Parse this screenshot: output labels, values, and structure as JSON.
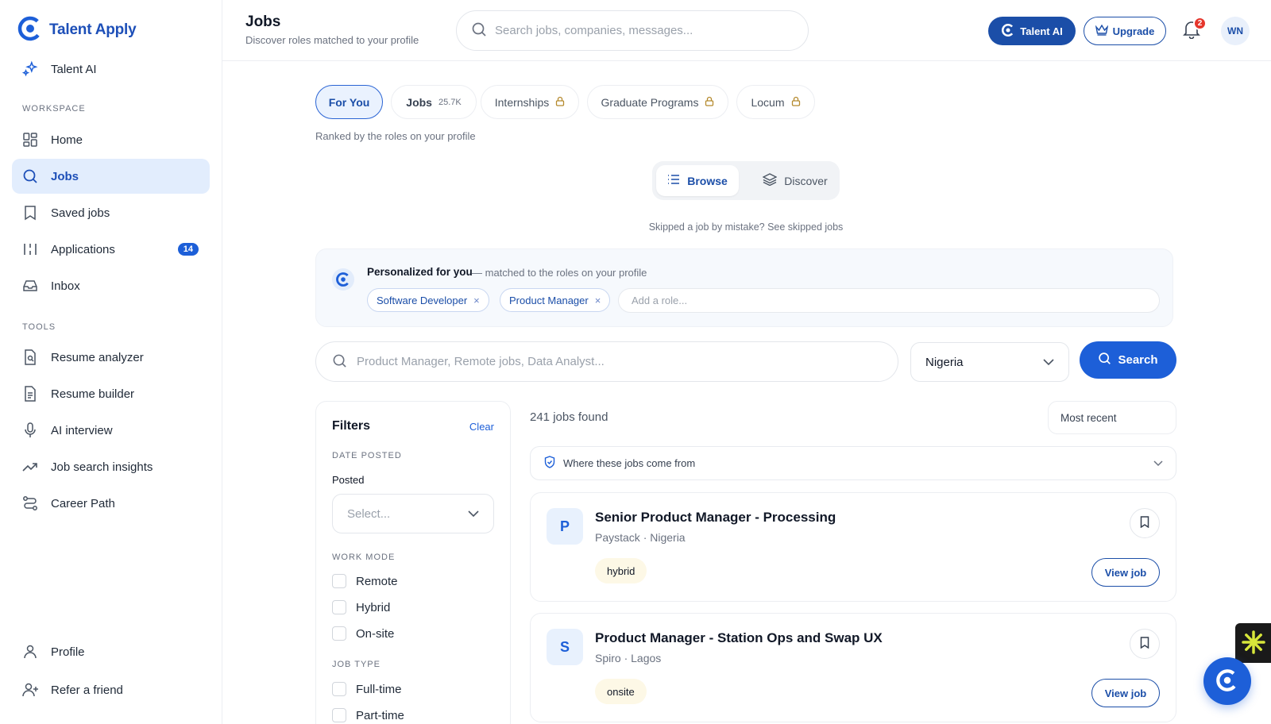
{
  "brand": {
    "name": "Talent Apply"
  },
  "sidebar": {
    "top_item": {
      "label": "Talent AI"
    },
    "workspace_label": "WORKSPACE",
    "workspace": [
      {
        "label": "Home"
      },
      {
        "label": "Jobs",
        "active": true
      },
      {
        "label": "Saved jobs"
      },
      {
        "label": "Applications",
        "badge": "14"
      },
      {
        "label": "Inbox"
      }
    ],
    "tools_label": "TOOLS",
    "tools": [
      {
        "label": "Resume analyzer"
      },
      {
        "label": "Resume builder"
      },
      {
        "label": "AI interview"
      },
      {
        "label": "Job search insights"
      },
      {
        "label": "Career Path"
      }
    ],
    "bottom": [
      {
        "label": "Profile"
      },
      {
        "label": "Refer a friend"
      }
    ]
  },
  "header": {
    "title": "Jobs",
    "subtitle": "Discover roles matched to your profile",
    "search_placeholder": "Search jobs, companies, messages...",
    "talent_ai_label": "Talent AI",
    "upgrade_label": "Upgrade",
    "notification_count": "2",
    "avatar_initials": "WN"
  },
  "tabs": [
    {
      "label": "For You",
      "active": true
    },
    {
      "label": "Jobs",
      "count": "25.7K"
    },
    {
      "label": "Internships",
      "locked": true
    },
    {
      "label": "Graduate Programs",
      "locked": true
    },
    {
      "label": "Locum",
      "locked": true
    }
  ],
  "ranked_text": "Ranked by the roles on your profile",
  "view_toggle": {
    "browse": "Browse",
    "discover": "Discover"
  },
  "skipped_text": "Skipped a job by mistake? See skipped jobs",
  "personalized": {
    "title": "Personalized for you",
    "subtitle": "— matched to the roles on your profile",
    "roles": [
      "Software Developer",
      "Product Manager"
    ],
    "add_placeholder": "Add a role..."
  },
  "search": {
    "placeholder": "Product Manager, Remote jobs, Data Analyst...",
    "location": "Nigeria",
    "button": "Search"
  },
  "filters": {
    "title": "Filters",
    "clear": "Clear",
    "date_posted_label": "DATE POSTED",
    "posted_label": "Posted",
    "posted_placeholder": "Select...",
    "work_mode_label": "WORK MODE",
    "work_modes": [
      "Remote",
      "Hybrid",
      "On-site"
    ],
    "job_type_label": "JOB TYPE",
    "job_types": [
      "Full-time",
      "Part-time"
    ]
  },
  "results": {
    "count_text": "241 jobs found",
    "sort": "Most recent",
    "source_text": "Where these jobs come from",
    "jobs": [
      {
        "logo_letter": "P",
        "title": "Senior Product Manager - Processing",
        "meta": "Paystack · Nigeria",
        "tag": "hybrid",
        "view_label": "View job"
      },
      {
        "logo_letter": "S",
        "title": "Product Manager - Station Ops and Swap UX",
        "meta": "Spiro · Lagos",
        "tag": "onsite",
        "view_label": "View job"
      }
    ]
  },
  "colors": {
    "primary": "#1d5fd8",
    "brand_dark": "#1b4ea8",
    "active_bg": "#e2edfd",
    "tag_bg": "#fdf8e6"
  }
}
